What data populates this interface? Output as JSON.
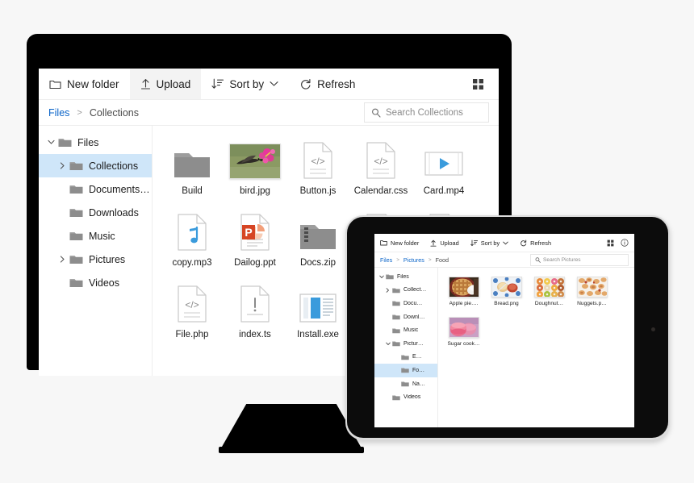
{
  "scene": {
    "devices": [
      "desktop-monitor",
      "tablet"
    ],
    "theme_accent": "#0a64c8",
    "selection_color": "#cfe6f9"
  },
  "monitor": {
    "toolbar": {
      "buttons": [
        {
          "label": "New folder",
          "icon": "new-folder-icon",
          "active": false
        },
        {
          "label": "Upload",
          "icon": "upload-icon",
          "active": true
        },
        {
          "label": "Sort by",
          "icon": "sort-icon",
          "caret": "chevron-down-icon",
          "active": false
        },
        {
          "label": "Refresh",
          "icon": "refresh-icon",
          "active": false
        }
      ],
      "view_toggle": "grid-view-icon"
    },
    "address": {
      "breadcrumbs": [
        {
          "label": "Files",
          "link": true
        },
        {
          "label": "Collections",
          "link": false
        }
      ],
      "separator": ">",
      "search_placeholder": "Search Collections",
      "search_value": "",
      "search_icon": "search-icon"
    },
    "tree": [
      {
        "label": "Files",
        "depth": 0,
        "chevron": "down",
        "selected": false
      },
      {
        "label": "Collections",
        "depth": 1,
        "chevron": "right",
        "selected": true
      },
      {
        "label": "Documents…",
        "depth": 1,
        "chevron": "none",
        "selected": false
      },
      {
        "label": "Downloads",
        "depth": 1,
        "chevron": "none",
        "selected": false
      },
      {
        "label": "Music",
        "depth": 1,
        "chevron": "none",
        "selected": false
      },
      {
        "label": "Pictures",
        "depth": 1,
        "chevron": "right",
        "selected": false
      },
      {
        "label": "Videos",
        "depth": 1,
        "chevron": "none",
        "selected": false
      }
    ],
    "files": [
      {
        "name": "Build",
        "kind": "folder"
      },
      {
        "name": "bird.jpg",
        "kind": "image-hummingbird"
      },
      {
        "name": "Button.js",
        "kind": "code-file"
      },
      {
        "name": "Calendar.css",
        "kind": "code-file"
      },
      {
        "name": "Card.mp4",
        "kind": "video-file"
      },
      {
        "name": "copy.mp3",
        "kind": "audio-file"
      },
      {
        "name": "Dailog.ppt",
        "kind": "powerpoint-file"
      },
      {
        "name": "Docs.zip",
        "kind": "zip-folder"
      },
      {
        "name": "",
        "kind": "html-file"
      },
      {
        "name": "",
        "kind": "doc-file"
      },
      {
        "name": "File.php",
        "kind": "code-file"
      },
      {
        "name": "index.ts",
        "kind": "alert-file"
      },
      {
        "name": "Install.exe",
        "kind": "exe-file"
      }
    ]
  },
  "tablet": {
    "toolbar": {
      "buttons": [
        {
          "label": "New folder",
          "icon": "new-folder-icon",
          "active": false
        },
        {
          "label": "Upload",
          "icon": "upload-icon",
          "active": false
        },
        {
          "label": "Sort by",
          "icon": "sort-icon",
          "caret": "chevron-down-icon",
          "active": false
        },
        {
          "label": "Refresh",
          "icon": "refresh-icon",
          "active": false
        }
      ],
      "view_toggle": "grid-view-icon",
      "info_button": "info-icon"
    },
    "address": {
      "breadcrumbs": [
        {
          "label": "Files",
          "link": true
        },
        {
          "label": "Pictures",
          "link": true
        },
        {
          "label": "Food",
          "link": false
        }
      ],
      "separator": ">",
      "search_placeholder": "Search Pictures",
      "search_value": "",
      "search_icon": "search-icon"
    },
    "tree": [
      {
        "label": "Files",
        "depth": 0,
        "chevron": "down",
        "selected": false
      },
      {
        "label": "Collect…",
        "depth": 1,
        "chevron": "right",
        "selected": false
      },
      {
        "label": "Docu…",
        "depth": 1,
        "chevron": "none",
        "selected": false
      },
      {
        "label": "Downl…",
        "depth": 1,
        "chevron": "none",
        "selected": false
      },
      {
        "label": "Music",
        "depth": 1,
        "chevron": "none",
        "selected": false
      },
      {
        "label": "Pictur…",
        "depth": 1,
        "chevron": "down",
        "selected": false
      },
      {
        "label": "E…",
        "depth": 2,
        "chevron": "none",
        "selected": false
      },
      {
        "label": "Fo…",
        "depth": 2,
        "chevron": "none",
        "selected": true
      },
      {
        "label": "Na…",
        "depth": 2,
        "chevron": "none",
        "selected": false
      },
      {
        "label": "Videos",
        "depth": 1,
        "chevron": "none",
        "selected": false
      }
    ],
    "files": [
      {
        "name": "Apple pie….",
        "kind": "image-apple-pie"
      },
      {
        "name": "Bread.png",
        "kind": "image-bread"
      },
      {
        "name": "Doughnut…",
        "kind": "image-doughnuts"
      },
      {
        "name": "Nuggets.p…",
        "kind": "image-nuggets"
      },
      {
        "name": "Sugar cook…",
        "kind": "image-macarons"
      }
    ]
  }
}
